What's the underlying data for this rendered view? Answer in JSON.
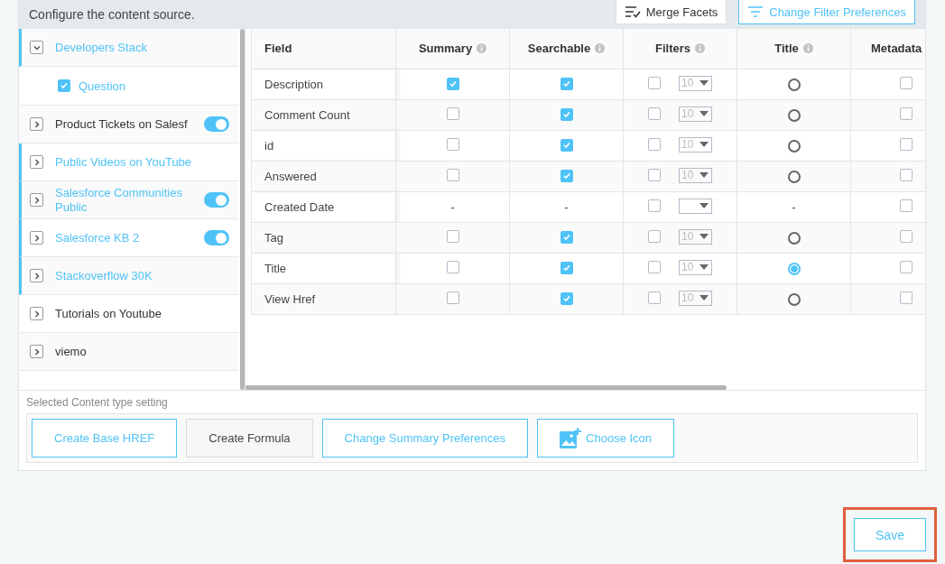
{
  "header": {
    "title": "Configure the content source.",
    "buttons": [
      {
        "label": "Merge Facets",
        "kind": "plain"
      },
      {
        "label": "Change Filter Preferences",
        "kind": "primary"
      }
    ]
  },
  "sources": [
    {
      "label": "Developers Stack",
      "selected": true,
      "expanded": true,
      "children": [
        {
          "label": "Question",
          "checked": true
        }
      ]
    },
    {
      "label": "Product Tickets on Salesf",
      "selected": false,
      "expanded": false,
      "toggle": true
    },
    {
      "label": "Public Videos on YouTube",
      "selected": true,
      "expanded": false
    },
    {
      "label": "Salesforce Communities Public",
      "selected": true,
      "expanded": false,
      "toggle": true
    },
    {
      "label": "Salesforce KB 2",
      "selected": true,
      "expanded": false,
      "toggle": true
    },
    {
      "label": "Stackoverflow 30K",
      "selected": true,
      "expanded": false
    },
    {
      "label": "Tutorials on Youtube",
      "selected": false,
      "expanded": false
    },
    {
      "label": "viemo",
      "selected": false,
      "expanded": false
    }
  ],
  "table": {
    "columns": [
      {
        "label": "Field",
        "info": false
      },
      {
        "label": "Summary",
        "info": true
      },
      {
        "label": "Searchable",
        "info": true
      },
      {
        "label": "Filters",
        "info": true
      },
      {
        "label": "Title",
        "info": true
      },
      {
        "label": "Metadata"
      }
    ],
    "rows": [
      {
        "field": "Description",
        "summary": {
          "kind": "checkbox",
          "checked": true
        },
        "searchable": {
          "kind": "checkbox",
          "checked": true
        },
        "filter": {
          "checked": false,
          "count": "10"
        },
        "title": {
          "kind": "radio",
          "selected": false
        },
        "metadata": {
          "checked": false
        }
      },
      {
        "field": "Comment Count",
        "summary": {
          "kind": "checkbox",
          "checked": false
        },
        "searchable": {
          "kind": "checkbox",
          "checked": true
        },
        "filter": {
          "checked": false,
          "count": "10"
        },
        "title": {
          "kind": "radio",
          "selected": false
        },
        "metadata": {
          "checked": false
        }
      },
      {
        "field": "id",
        "summary": {
          "kind": "checkbox",
          "checked": false
        },
        "searchable": {
          "kind": "checkbox",
          "checked": true
        },
        "filter": {
          "checked": false,
          "count": "10"
        },
        "title": {
          "kind": "radio",
          "selected": false
        },
        "metadata": {
          "checked": false
        }
      },
      {
        "field": "Answered",
        "summary": {
          "kind": "checkbox",
          "checked": false
        },
        "searchable": {
          "kind": "checkbox",
          "checked": true
        },
        "filter": {
          "checked": false,
          "count": "10"
        },
        "title": {
          "kind": "radio",
          "selected": false
        },
        "metadata": {
          "checked": false
        }
      },
      {
        "field": "Created Date",
        "summary": {
          "kind": "dash",
          "text": "-"
        },
        "searchable": {
          "kind": "dash",
          "text": "-"
        },
        "filter": {
          "checked": false
        },
        "title": {
          "kind": "dash",
          "text": "-"
        },
        "metadata": {
          "checked": false
        }
      },
      {
        "field": "Tag",
        "summary": {
          "kind": "checkbox",
          "checked": false
        },
        "searchable": {
          "kind": "checkbox",
          "checked": true
        },
        "filter": {
          "checked": false,
          "count": "10"
        },
        "title": {
          "kind": "radio",
          "selected": false
        },
        "metadata": {
          "checked": false
        }
      },
      {
        "field": "Title",
        "summary": {
          "kind": "checkbox",
          "checked": false
        },
        "searchable": {
          "kind": "checkbox",
          "checked": true
        },
        "filter": {
          "checked": false,
          "count": "10"
        },
        "title": {
          "kind": "radio",
          "selected": true
        },
        "metadata": {
          "checked": false
        }
      },
      {
        "field": "View Href",
        "summary": {
          "kind": "checkbox",
          "checked": false
        },
        "searchable": {
          "kind": "checkbox",
          "checked": true
        },
        "filter": {
          "checked": false,
          "count": "10"
        },
        "title": {
          "kind": "radio",
          "selected": false
        },
        "metadata": {
          "checked": false
        }
      }
    ]
  },
  "settings": {
    "title": "Selected Content type setting",
    "buttons": [
      {
        "label": "Create Base HREF",
        "kind": "primary"
      },
      {
        "label": "Create Formula",
        "kind": "plain"
      },
      {
        "label": "Change Summary Preferences",
        "kind": "primary"
      },
      {
        "label": "Choose Icon",
        "kind": "icon"
      }
    ]
  },
  "save": {
    "label": "Save",
    "highlighted": true
  }
}
